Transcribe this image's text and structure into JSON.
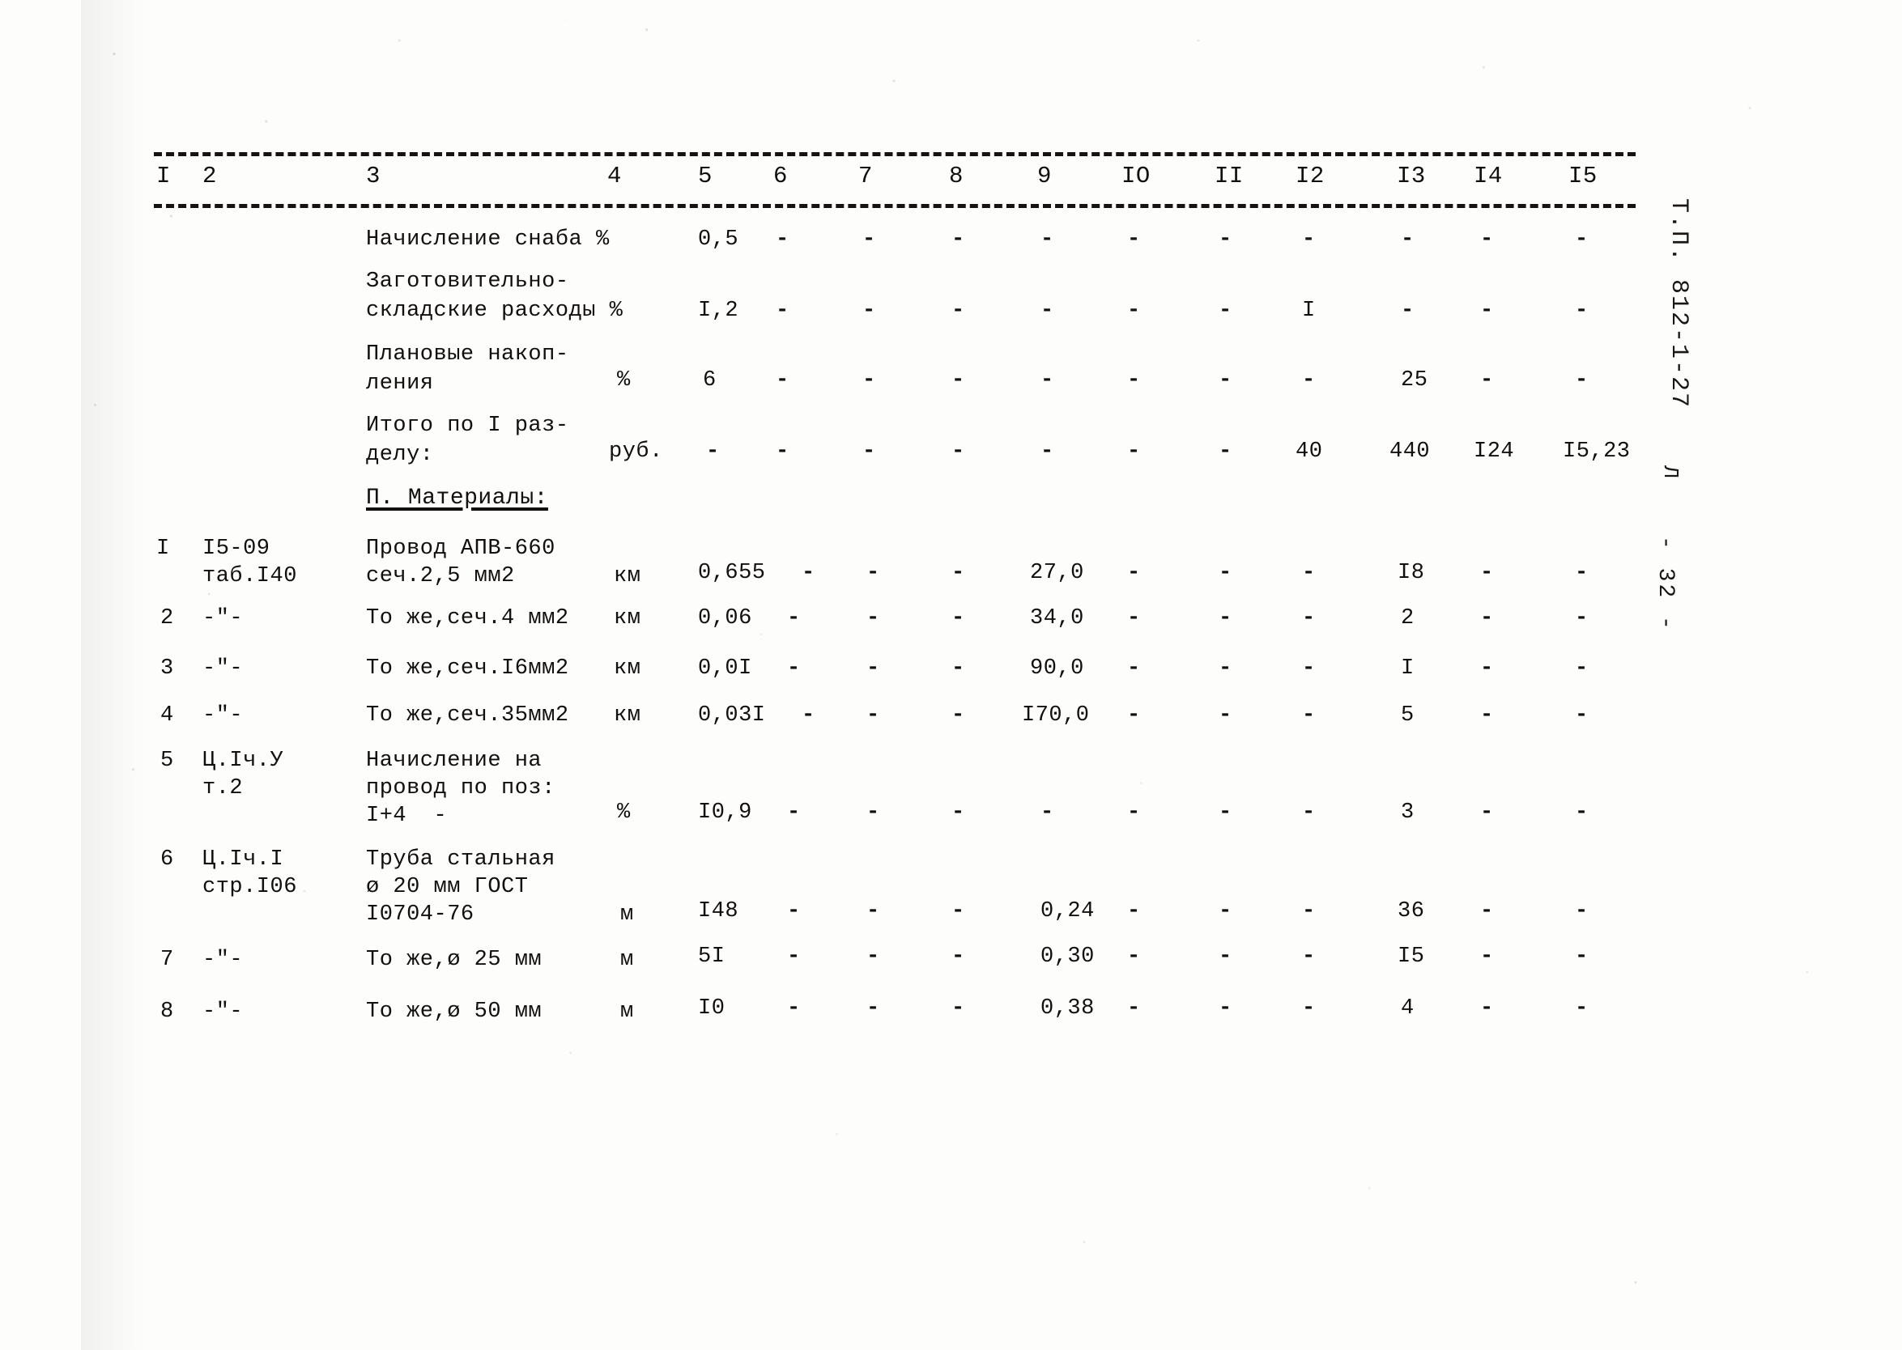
{
  "document": {
    "margin_code": "Т.П. 812-1-27",
    "margin_page": "- 32 -",
    "margin_tick": "Л"
  },
  "table": {
    "column_headers": [
      "I",
      "2",
      "3",
      "4",
      "5",
      "6",
      "7",
      "8",
      "9",
      "IO",
      "II",
      "I2",
      "I3",
      "I4",
      "I5"
    ],
    "section_heading": "П. Материалы:",
    "rows": [
      {
        "pos": "",
        "ref": "",
        "name_lines": [
          "Начисление снаба %"
        ],
        "unit": "",
        "c5": "0,5",
        "c6": "-",
        "c7": "-",
        "c8": "-",
        "c9": "-",
        "c10": "-",
        "c11": "-",
        "c12": "-",
        "c13": "-",
        "c14": "-",
        "c15": "-"
      },
      {
        "pos": "",
        "ref": "",
        "name_lines": [
          "Заготовительно-",
          "складские расходы %"
        ],
        "unit": "",
        "c5": "I,2",
        "c6": "-",
        "c7": "-",
        "c8": "-",
        "c9": "-",
        "c10": "-",
        "c11": "-",
        "c12": "I",
        "c13": "-",
        "c14": "-",
        "c15": "-"
      },
      {
        "pos": "",
        "ref": "",
        "name_lines": [
          "Плановые накоп-",
          "ления"
        ],
        "unit": "%",
        "c5": "6",
        "c6": "-",
        "c7": "-",
        "c8": "-",
        "c9": "-",
        "c10": "-",
        "c11": "-",
        "c12": "-",
        "c13": "25",
        "c14": "-",
        "c15": "-"
      },
      {
        "pos": "",
        "ref": "",
        "name_lines": [
          "Итого по I раз-",
          "делу:"
        ],
        "unit": "руб.",
        "c5": "-",
        "c6": "-",
        "c7": "-",
        "c8": "-",
        "c9": "-",
        "c10": "-",
        "c11": "-",
        "c12": "40",
        "c13": "440",
        "c14": "I24",
        "c15": "I5,23"
      },
      {
        "pos": "I",
        "ref_lines": [
          "I5-09",
          "таб.I40"
        ],
        "name_lines": [
          "Провод АПВ-660",
          "сеч.2,5 мм2"
        ],
        "unit": "км",
        "c5": "0,655",
        "c6": "-",
        "c7": "-",
        "c8": "-",
        "c9": "27,0",
        "c10": "-",
        "c11": "-",
        "c12": "-",
        "c13": "I8",
        "c14": "-",
        "c15": "-"
      },
      {
        "pos": "2",
        "ref_lines": [
          "-\"-"
        ],
        "name_lines": [
          "То же,сеч.4 мм2"
        ],
        "unit": "км",
        "c5": "0,06",
        "c6": "-",
        "c7": "-",
        "c8": "-",
        "c9": "34,0",
        "c10": "-",
        "c11": "-",
        "c12": "-",
        "c13": "2",
        "c14": "-",
        "c15": "-"
      },
      {
        "pos": "3",
        "ref_lines": [
          "-\"-"
        ],
        "name_lines": [
          "То же,сеч.I6мм2"
        ],
        "unit": "км",
        "c5": "0,0I",
        "c6": "-",
        "c7": "-",
        "c8": "-",
        "c9": "90,0",
        "c10": "-",
        "c11": "-",
        "c12": "-",
        "c13": "I",
        "c14": "-",
        "c15": "-"
      },
      {
        "pos": "4",
        "ref_lines": [
          "-\"-"
        ],
        "name_lines": [
          "То же,сеч.35мм2"
        ],
        "unit": "км",
        "c5": "0,03I",
        "c6": "-",
        "c7": "-",
        "c8": "-",
        "c9": "I70,0",
        "c10": "-",
        "c11": "-",
        "c12": "-",
        "c13": "5",
        "c14": "-",
        "c15": "-"
      },
      {
        "pos": "5",
        "ref_lines": [
          "Ц.Iч.У",
          "т.2"
        ],
        "name_lines": [
          "Начисление на",
          "провод по поз:",
          "I+4  -"
        ],
        "unit": "%",
        "c5": "I0,9",
        "c6": "-",
        "c7": "-",
        "c8": "-",
        "c9": "-",
        "c10": "-",
        "c11": "-",
        "c12": "-",
        "c13": "3",
        "c14": "-",
        "c15": "-"
      },
      {
        "pos": "6",
        "ref_lines": [
          "Ц.Iч.I",
          "стр.I06"
        ],
        "name_lines": [
          "Труба стальная",
          "ø 20 мм ГОСТ",
          "I0704-76"
        ],
        "unit": "м",
        "c5": "I48",
        "c6": "-",
        "c7": "-",
        "c8": "-",
        "c9": "0,24",
        "c10": "-",
        "c11": "-",
        "c12": "-",
        "c13": "36",
        "c14": "-",
        "c15": "-"
      },
      {
        "pos": "7",
        "ref_lines": [
          "-\"-"
        ],
        "name_lines": [
          "То же,ø 25 мм"
        ],
        "unit": "м",
        "c5": "5I",
        "c6": "-",
        "c7": "-",
        "c8": "-",
        "c9": "0,30",
        "c10": "-",
        "c11": "-",
        "c12": "-",
        "c13": "I5",
        "c14": "-",
        "c15": "-"
      },
      {
        "pos": "8",
        "ref_lines": [
          "-\"-"
        ],
        "name_lines": [
          "То же,ø 50 мм"
        ],
        "unit": "м",
        "c5": "I0",
        "c6": "-",
        "c7": "-",
        "c8": "-",
        "c9": "0,38",
        "c10": "-",
        "c11": "-",
        "c12": "-",
        "c13": "4",
        "c14": "-",
        "c15": "-"
      }
    ]
  }
}
